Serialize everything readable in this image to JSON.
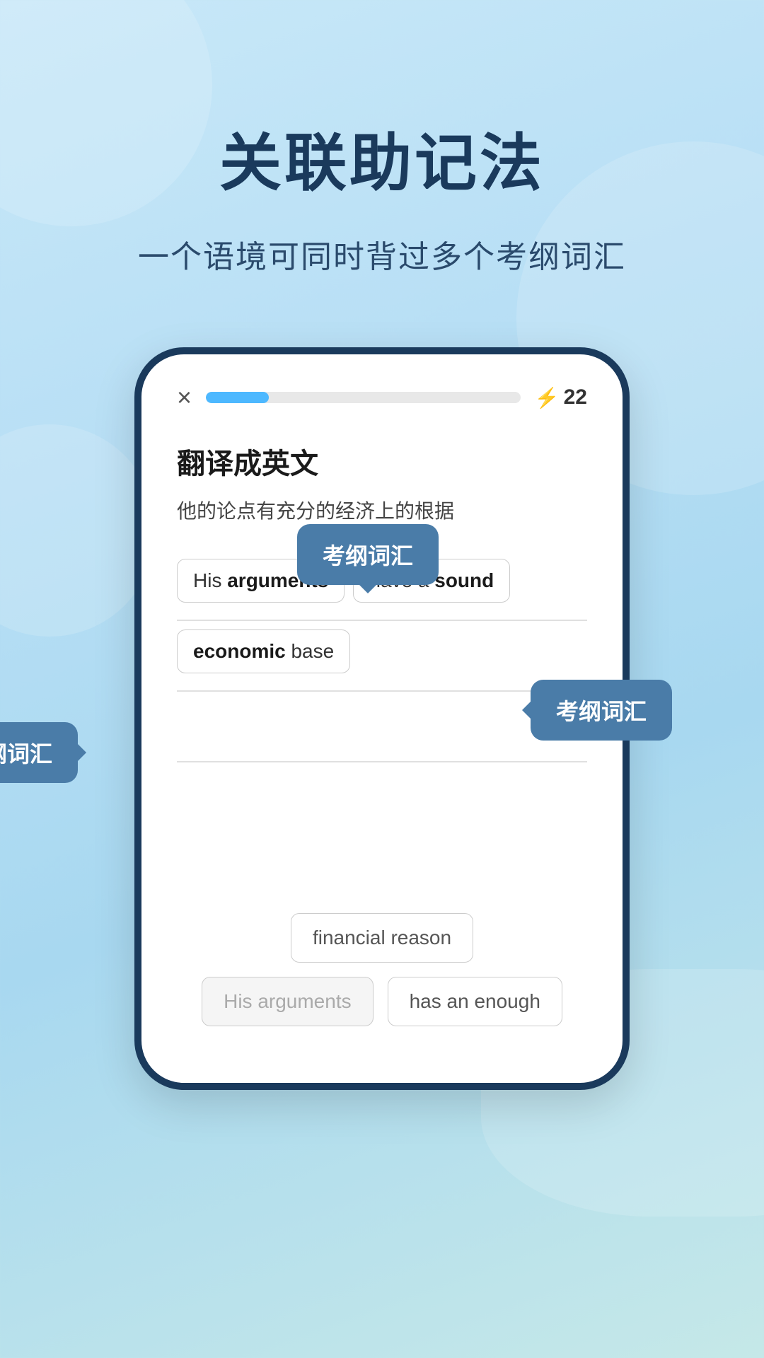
{
  "page": {
    "background": "#b8ddf0"
  },
  "header": {
    "title": "关联助记法",
    "subtitle": "一个语境可同时背过多个考纲词汇"
  },
  "phone": {
    "topbar": {
      "close_label": "×",
      "progress_percent": 20,
      "lightning_icon": "⚡",
      "score": "22"
    },
    "question": {
      "label": "翻译成英文",
      "text": "他的论点有充分的经济上的根据"
    },
    "answer_line1": {
      "part1": "His ",
      "keyword1": "arguments",
      "part2": "have a ",
      "keyword2": "sound"
    },
    "answer_line2": {
      "keyword1": "economic",
      "part1": " base"
    },
    "choices": {
      "row1": [
        "financial reason"
      ],
      "row2_1": "His arguments",
      "row2_2": "has an enough"
    },
    "tooltips": [
      {
        "label": "考纲词汇",
        "position": "top-center"
      },
      {
        "label": "考纲词汇",
        "position": "right"
      },
      {
        "label": "考纲词汇",
        "position": "left"
      }
    ]
  }
}
